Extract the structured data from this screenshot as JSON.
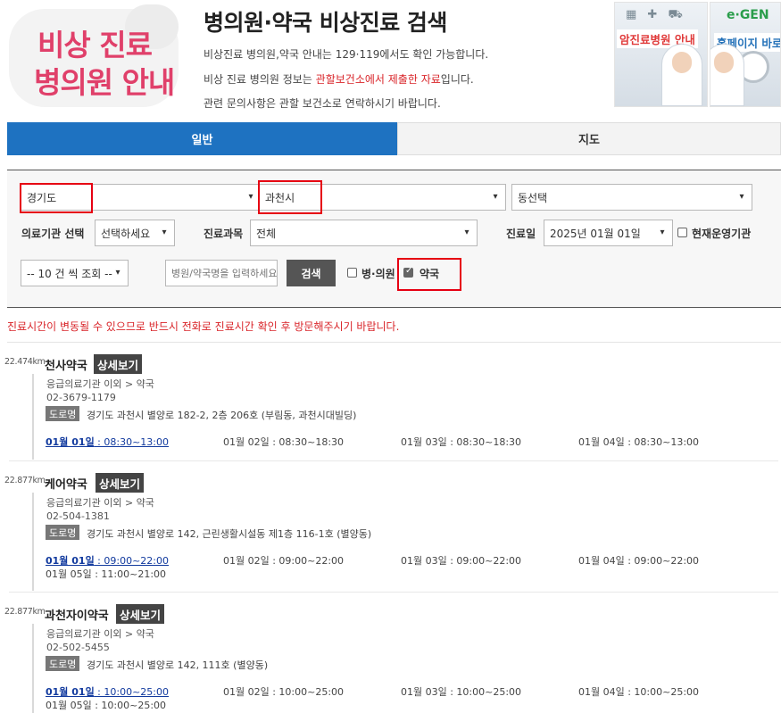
{
  "header": {
    "logo_line1": "비상 진료",
    "logo_line2": "병의원 안내",
    "title": "병의원·약국 비상진료 검색",
    "info1": "비상진료 병의원,약국 안내는 129·119에서도 확인 가능합니다.",
    "info2_pre": "비상 진료 병의원 정보는 ",
    "info2_red": "관할보건소에서 제출한 자료",
    "info2_post": "입니다.",
    "info3": "관련 문의사항은 관할 보건소로 연락하시기 바랍니다.",
    "banner1_label": "암진료병원 안내",
    "banner2_label": "홈페이지 바로가"
  },
  "tabs": [
    {
      "label": "일반",
      "active": true
    },
    {
      "label": "지도",
      "active": false
    }
  ],
  "filters": {
    "province": "경기도",
    "city": "과천시",
    "dong": "동선택",
    "institution_label": "의료기관 선택",
    "institution_value": "선택하세요",
    "department_label": "진료과목",
    "department_value": "전체",
    "date_label": "진료일",
    "date_value": "2025년 01월 01일",
    "open_now_label": "현재운영기관",
    "open_now_checked": false,
    "page_size": "-- 10 건 씩 조회 --",
    "search_placeholder": "병원/약국명을 입력하세요",
    "search_button": "검색",
    "hospital_label": "병·의원",
    "hospital_checked": false,
    "pharmacy_label": "약국",
    "pharmacy_checked": true
  },
  "notice": "진료시간이 변동될 수 있으므로 반드시 전화로 진료시간 확인 후 방문해주시기 바랍니다.",
  "detail_label": "상세보기",
  "road_label": "도로명",
  "results": [
    {
      "distance": "22.474km",
      "name": "천사약국",
      "category": "응급의료기관 이외 > 약국",
      "phone": "02-3679-1179",
      "address": "경기도 과천시 별양로 182-2, 2층 206호 (부림동, 과천시대빌딩)",
      "hours": [
        {
          "day": "01월 01일",
          "time": " : 08:30~13:00"
        },
        {
          "day": "01월 02일",
          "time": " : 08:30~18:30"
        },
        {
          "day": "01월 03일",
          "time": " : 08:30~18:30"
        },
        {
          "day": "01월 04일",
          "time": " : 08:30~13:00"
        }
      ]
    },
    {
      "distance": "22.877km",
      "name": "케어약국",
      "category": "응급의료기관 이외 > 약국",
      "phone": "02-504-1381",
      "address": "경기도 과천시 별양로 142, 근린생활시설동 제1층 116-1호 (별양동)",
      "hours": [
        {
          "day": "01월 01일",
          "time": " : 09:00~22:00"
        },
        {
          "day": "01월 02일",
          "time": " : 09:00~22:00"
        },
        {
          "day": "01월 03일",
          "time": " : 09:00~22:00"
        },
        {
          "day": "01월 04일",
          "time": " : 09:00~22:00"
        },
        {
          "day": "01월 05일",
          "time": " : 11:00~21:00"
        }
      ]
    },
    {
      "distance": "22.877km",
      "name": "과천자이약국",
      "category": "응급의료기관 이외 > 약국",
      "phone": "02-502-5455",
      "address": "경기도 과천시 별양로 142, 111호 (별양동)",
      "hours": [
        {
          "day": "01월 01일",
          "time": " : 10:00~25:00"
        },
        {
          "day": "01월 02일",
          "time": " : 10:00~25:00"
        },
        {
          "day": "01월 03일",
          "time": " : 10:00~25:00"
        },
        {
          "day": "01월 04일",
          "time": " : 10:00~25:00"
        },
        {
          "day": "01월 05일",
          "time": " : 10:00~25:00"
        }
      ]
    }
  ]
}
